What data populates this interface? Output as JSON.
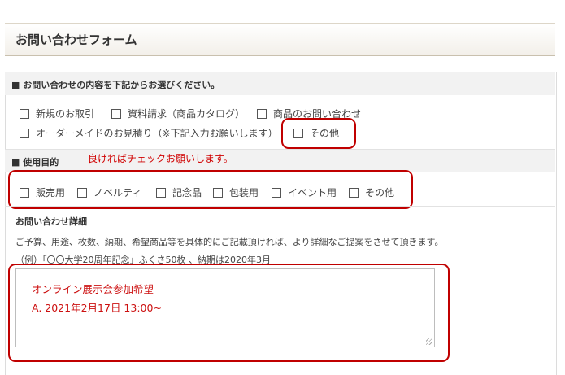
{
  "page_title": "お問い合わせフォーム",
  "section1": {
    "heading": "■ お問い合わせの内容を下記からお選びください。",
    "options": [
      {
        "label": "新規のお取引",
        "checked": false
      },
      {
        "label": "資料請求（商品カタログ）",
        "checked": false
      },
      {
        "label": "商品のお問い合わせ",
        "checked": false
      },
      {
        "label": "オーダーメイドのお見積り（※下記入力お願いします）",
        "checked": false
      },
      {
        "label": "その他",
        "checked": false
      }
    ]
  },
  "section2": {
    "heading": "■ 使用目的",
    "annotation": "良ければチェックお願いします。",
    "options": [
      {
        "label": "販売用",
        "checked": false
      },
      {
        "label": "ノベルティ",
        "checked": false
      },
      {
        "label": "記念品",
        "checked": false
      },
      {
        "label": "包装用",
        "checked": false
      },
      {
        "label": "イベント用",
        "checked": false
      },
      {
        "label": "その他",
        "checked": false
      }
    ]
  },
  "section3": {
    "heading": "お問い合わせ詳細",
    "description": "ご予算、用途、枚数、納期、希望商品等を具体的にご記載頂ければ、より詳細なご提案をさせて頂きます。",
    "example": "（例）「〇〇大学20周年記念」ふくさ50枚 、納期は2020年3月",
    "textarea_lines": [
      "オンライン展示会参加希望",
      "A. 2021年2月17日  13:00~"
    ]
  },
  "colors": {
    "annotation_red": "#cc0000",
    "header_bg": "#f2f2f2"
  }
}
